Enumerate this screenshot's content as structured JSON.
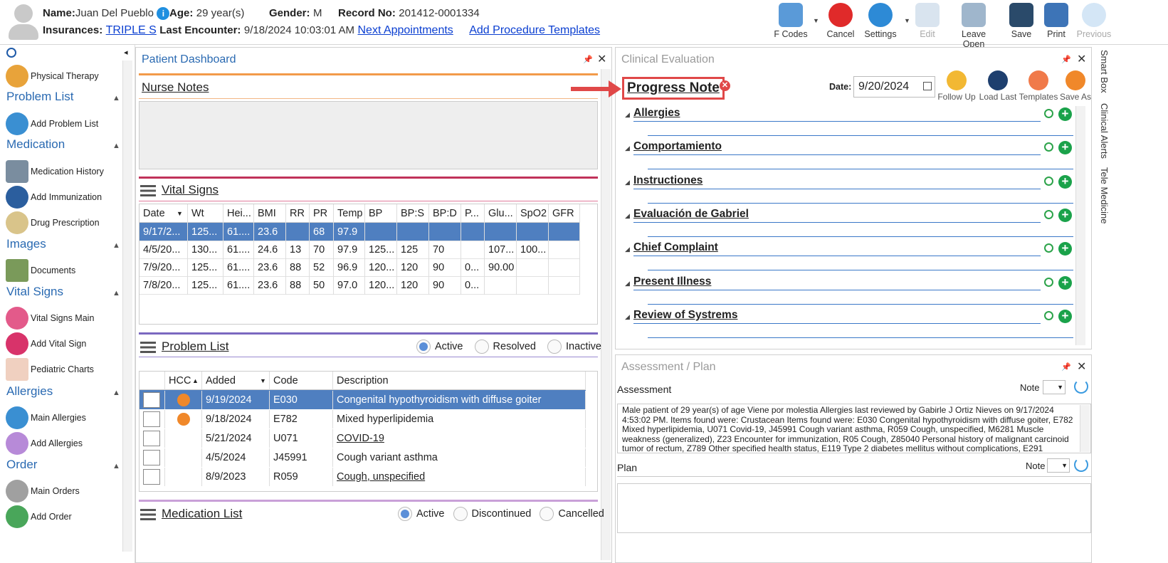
{
  "patient": {
    "name_label": "Name:",
    "name": "Juan Del Pueblo",
    "age_label": "Age:",
    "age": "29 year(s)",
    "gender_label": "Gender:",
    "gender": "M",
    "record_label": "Record No:",
    "record": "201412-0001334",
    "insurance_label": "Insurances:",
    "insurance": "TRIPLE S",
    "last_enc_label": "Last Encounter:",
    "last_enc": "9/18/2024 10:03:01 AM",
    "next_appt": "Next Appointments",
    "add_proc": "Add Procedure Templates"
  },
  "toolbar": {
    "fcodes": "F Codes",
    "cancel": "Cancel",
    "settings": "Settings",
    "edit": "Edit",
    "leave_open": "Leave Open",
    "save": "Save",
    "print": "Print",
    "previous": "Previous"
  },
  "sidebar": {
    "physical_therapy": "Physical Therapy",
    "problem_list": "Problem List",
    "add_problem_list": "Add Problem List",
    "medication": "Medication",
    "medication_history": "Medication History",
    "add_immunization": "Add Immunization",
    "drug_prescription": "Drug Prescription",
    "images": "Images",
    "documents": "Documents",
    "vital_signs": "Vital Signs",
    "vital_signs_main": "Vital Signs Main",
    "add_vital_sign": "Add Vital Sign",
    "pediatric_charts": "Pediatric Charts",
    "allergies": "Allergies",
    "main_allergies": "Main Allergies",
    "add_allergies": "Add Allergies",
    "order": "Order",
    "main_orders": "Main Orders",
    "add_order": "Add Order"
  },
  "dashboard": {
    "title": "Patient Dashboard",
    "nurse_notes": "Nurse Notes",
    "vital_signs": "Vital Signs",
    "vitals_headers": [
      "Date",
      "Wt",
      "Hei...",
      "BMI",
      "RR",
      "PR",
      "Temp",
      "BP",
      "BP:S",
      "BP:D",
      "P...",
      "Glu...",
      "SpO2",
      "GFR"
    ],
    "vitals_rows": [
      [
        "9/17/2...",
        "125...",
        "61....",
        "23.6",
        "",
        "68",
        "97.9",
        "",
        "",
        "",
        "",
        "",
        "",
        ""
      ],
      [
        "4/5/20...",
        "130...",
        "61....",
        "24.6",
        "13",
        "70",
        "97.9",
        "125...",
        "125",
        "70",
        "",
        "107...",
        "100...",
        ""
      ],
      [
        "7/9/20...",
        "125...",
        "61....",
        "23.6",
        "88",
        "52",
        "96.9",
        "120...",
        "120",
        "90",
        "0...",
        "90.00",
        "",
        ""
      ],
      [
        "7/8/20...",
        "125...",
        "61....",
        "23.6",
        "88",
        "50",
        "97.0",
        "120...",
        "120",
        "90",
        "0...",
        "",
        "",
        ""
      ]
    ],
    "problem_list": "Problem List",
    "pl_filters": [
      "Active",
      "Resolved",
      "Inactive"
    ],
    "pl_headers": [
      "HCC",
      "Added",
      "Code",
      "Description"
    ],
    "pl_rows": [
      {
        "hcc": true,
        "added": "9/19/2024",
        "code": "E030",
        "desc": "Congenital hypothyroidism with diffuse goiter"
      },
      {
        "hcc": true,
        "added": "9/18/2024",
        "code": "E782",
        "desc": "Mixed hyperlipidemia"
      },
      {
        "hcc": false,
        "added": "5/21/2024",
        "code": "U071",
        "desc": "COVID-19"
      },
      {
        "hcc": false,
        "added": "4/5/2024",
        "code": "J45991",
        "desc": "Cough variant asthma"
      },
      {
        "hcc": false,
        "added": "8/9/2023",
        "code": "R059",
        "desc": "Cough, unspecified"
      }
    ],
    "medication_list": "Medication List",
    "ml_filters": [
      "Active",
      "Discontinued",
      "Cancelled"
    ]
  },
  "clinical": {
    "title": "Clinical Evaluation",
    "note_title": "Progress Note",
    "date_label": "Date:",
    "date": "9/20/2024",
    "actions": [
      "Follow Up",
      "Load Last",
      "Templates",
      "Save As"
    ],
    "sections": [
      "Allergies",
      "Comportamiento",
      "Instructiones",
      "Evaluación de Gabriel",
      "Chief Complaint",
      "Present Illness",
      "Review of Systrems"
    ]
  },
  "assessment": {
    "title": "Assessment / Plan",
    "assessment_label": "Assessment",
    "note_label": "Note",
    "text": "Male patient of 29 year(s) of age Viene por molestia    Allergies last reviewed by Gabirle J Ortiz Nieves on 9/17/2024 4:53:02 PM.   Items found were:  Crustacean  Items found were:  E030 Congenital hypothyroidism with diffuse goiter, E782 Mixed hyperlipidemia, U071 Covid-19, J45991 Cough variant asthma, R059 Cough, unspecified, M6281 Muscle weakness (generalized), Z23 Encounter for immunization, R05 Cough, Z85040 Personal history of malignant carcinoid tumor of rectum, Z789 Other specified health status, E119 Type 2 diabetes mellitus without complications, E291",
    "plan_label": "Plan"
  },
  "right_tabs": [
    "Smart Box",
    "Clinical Alerts",
    "Tele Medicine"
  ]
}
